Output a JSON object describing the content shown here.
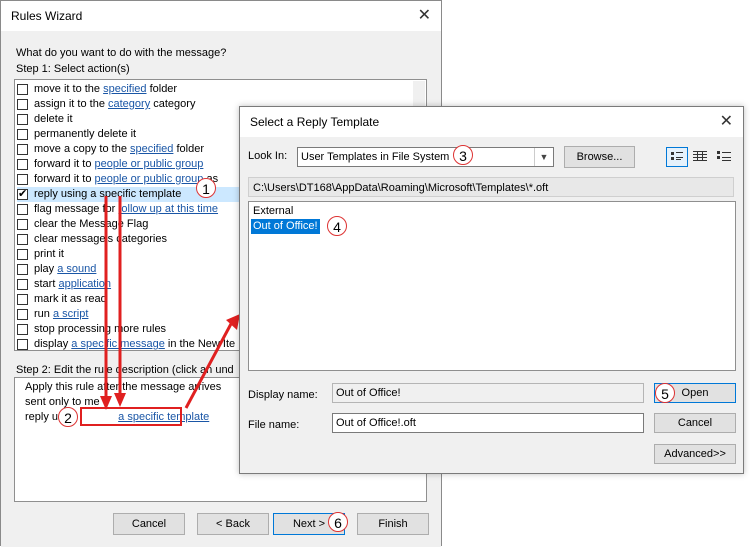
{
  "rules_wizard": {
    "title": "Rules Wizard",
    "question": "What do you want to do with the message?",
    "step1": "Step 1: Select action(s)",
    "actions": [
      {
        "pre": "move it to the ",
        "link": "specified",
        "post": " folder",
        "checked": false
      },
      {
        "pre": "assign it to the ",
        "link": "category",
        "post": " category",
        "checked": false
      },
      {
        "pre": "delete it",
        "link": "",
        "post": "",
        "checked": false
      },
      {
        "pre": "permanently delete it",
        "link": "",
        "post": "",
        "checked": false
      },
      {
        "pre": "move a copy to the ",
        "link": "specified",
        "post": " folder",
        "checked": false
      },
      {
        "pre": "forward it to ",
        "link": "people or public group",
        "post": "",
        "checked": false
      },
      {
        "pre": "forward it to ",
        "link": "people or public group",
        "post": " as",
        "checked": false
      },
      {
        "pre": "reply using a specific template",
        "link": "",
        "post": "",
        "checked": true
      },
      {
        "pre": "flag message for ",
        "link": "follow up at this time",
        "post": "",
        "checked": false
      },
      {
        "pre": "clear the Message Flag",
        "link": "",
        "post": "",
        "checked": false
      },
      {
        "pre": "clear message's categories",
        "link": "",
        "post": "",
        "checked": false
      },
      {
        "pre": "print it",
        "link": "",
        "post": "",
        "checked": false
      },
      {
        "pre": "play ",
        "link": "a sound",
        "post": "",
        "checked": false
      },
      {
        "pre": "start ",
        "link": "application",
        "post": "",
        "checked": false
      },
      {
        "pre": "mark it as read",
        "link": "",
        "post": "",
        "checked": false
      },
      {
        "pre": "run ",
        "link": "a script",
        "post": "",
        "checked": false
      },
      {
        "pre": "stop processing more rules",
        "link": "",
        "post": "",
        "checked": false
      },
      {
        "pre": "display ",
        "link": "a specific message",
        "post": " in the New Ite",
        "checked": false
      }
    ],
    "step2": "Step 2: Edit the rule description (click an und",
    "desc_line1": "Apply this rule after the message arrives",
    "desc_line2": "sent only to me",
    "desc_line3_pre": "reply u",
    "desc_line3_link": "a specific template",
    "buttons": {
      "cancel": "Cancel",
      "back": "< Back",
      "next": "Next >",
      "finish": "Finish"
    }
  },
  "reply_template": {
    "title": "Select a Reply Template",
    "look_in_label": "Look In:",
    "look_in_value": "User Templates in File System",
    "browse": "Browse...",
    "path": "C:\\Users\\DT168\\AppData\\Roaming\\Microsoft\\Templates\\*.oft",
    "files": [
      "External",
      "Out of Office!"
    ],
    "selected_file": "Out of Office!",
    "display_name_label": "Display name:",
    "display_name_value": "Out of Office!",
    "file_name_label": "File name:",
    "file_name_value": "Out of Office!.oft",
    "open": "Open",
    "cancel": "Cancel",
    "advanced": "Advanced>>"
  },
  "callouts": [
    "1",
    "2",
    "3",
    "4",
    "5",
    "6"
  ],
  "colors": {
    "accent": "#0078d7",
    "selection": "#cce8ff",
    "annotation": "#e02020",
    "link": "#1a56a6"
  },
  "icons": {
    "close": "close-icon",
    "dropdown": "chevron-down-icon",
    "check": "checkmark-icon"
  }
}
